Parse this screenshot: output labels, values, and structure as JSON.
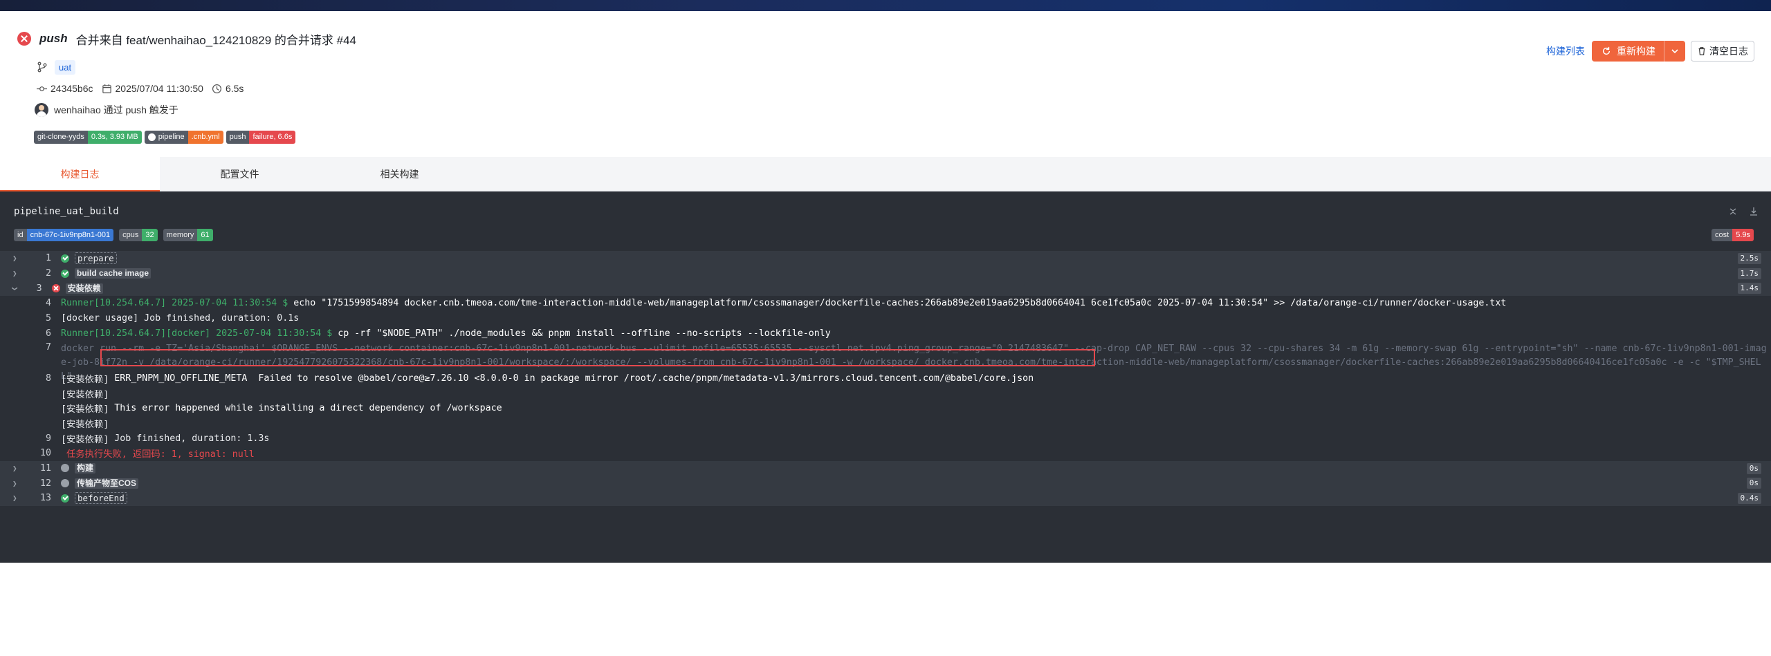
{
  "header": {
    "event": "push",
    "title": "合并来自 feat/wenhaihao_124210829 的合并请求 #44",
    "branch": "uat",
    "commit": "24345b6c",
    "datetime": "2025/07/04 11:30:50",
    "duration": "6.5s",
    "trigger": "wenhaihao 通过 push 触发于"
  },
  "badges": [
    {
      "key": "git-clone-yyds",
      "value": "0.3s, 3.93 MB"
    },
    {
      "key": "pipeline",
      "value": ".cnb.yml"
    },
    {
      "key": "push",
      "value": "failure, 6.6s"
    }
  ],
  "actions": {
    "build_list": "构建列表",
    "rebuild": "重新构建",
    "clear_log": "清空日志"
  },
  "tabs": [
    {
      "label": "构建日志"
    },
    {
      "label": "配置文件"
    },
    {
      "label": "相关构建"
    }
  ],
  "job": {
    "name": "pipeline_uat_build",
    "id_key": "id",
    "id_value": "cnb-67c-1iv9np8n1-001",
    "cpus_key": "cpus",
    "cpus_value": "32",
    "memory_key": "memory",
    "memory_value": "61",
    "cost_key": "cost",
    "cost_value": "5.9s"
  },
  "steps": [
    {
      "num": "1",
      "name": "prepare",
      "dur": "2.5s"
    },
    {
      "num": "2",
      "name": "build cache image",
      "dur": "1.7s"
    },
    {
      "num": "3",
      "name": "安装依赖",
      "dur": "1.4s"
    },
    {
      "num": "11",
      "name": "构建",
      "dur": "0s"
    },
    {
      "num": "12",
      "name": "传输产物至COS",
      "dur": "0s"
    },
    {
      "num": "13",
      "name": "beforeEnd",
      "dur": "0.4s"
    }
  ],
  "log": {
    "l4_prompt": "Runner[10.254.64.7] 2025-07-04 11:30:54 $ ",
    "l4_cmd": "echo \"1751599854894 docker.cnb.tmeoa.com/tme-interaction-middle-web/manageplatform/csossmanager/dockerfile-caches:266ab89e2e019aa6295b8d0664041 6ce1fc05a0c 2025-07-04 11:30:54\" >> /data/orange-ci/runner/docker-usage.txt",
    "l5": "[docker usage] Job finished, duration: 0.1s",
    "l6_prompt": "Runner[10.254.64.7][docker] 2025-07-04 11:30:54 $ ",
    "l6_cmd": "cp -rf \"$NODE_PATH\" ./node_modules && pnpm install --offline --no-scripts --lockfile-only",
    "l7": "docker run --rm -e TZ='Asia/Shanghai' $ORANGE_ENVS --network container:cnb-67c-1iv9np8n1-001-network-bus --ulimit nofile=65535:65535 --sysctl net.ipv4.ping_group_range=\"0 2147483647\"  --cap-drop CAP_NET_RAW --cpus 32 --cpu-shares 34 -m 61g --memory-swap 61g --entrypoint=\"sh\" --name cnb-67c-1iv9np8n1-001-image-job-8if72n -v /data/orange-ci/runner/1925477926075322368/cnb-67c-1iv9np8n1-001/workspace/:/workspace/ --volumes-from cnb-67c-1iv9np8n1-001  -w /workspace/ docker.cnb.tmeoa.com/tme-interaction-middle-web/manageplatform/csossmanager/dockerfile-caches:266ab89e2e019aa6295b8d06640416ce1fc05a0c -e -c \"$TMP_SHELL\"",
    "prefix": "[安装依赖]",
    "l8_err": " ERR_PNPM_NO_OFFLINE_META  Failed to resolve @babel/core@≥7.26.10 <8.0.0-0 in package mirror /root/.cache/pnpm/metadata-v1.3/mirrors.cloud.tencent.com/@babel/core.json",
    "l8c": " This error happened while installing a direct dependency of /workspace",
    "l9": " Job finished, duration: 1.3s",
    "l10": " 任务执行失败, 返回码: 1, signal: null"
  },
  "colors": {
    "accent": "#f0653c",
    "fail": "#e5484d",
    "success": "#3fae6a",
    "link": "#1d64d8",
    "log_bg": "#2b2f36"
  }
}
